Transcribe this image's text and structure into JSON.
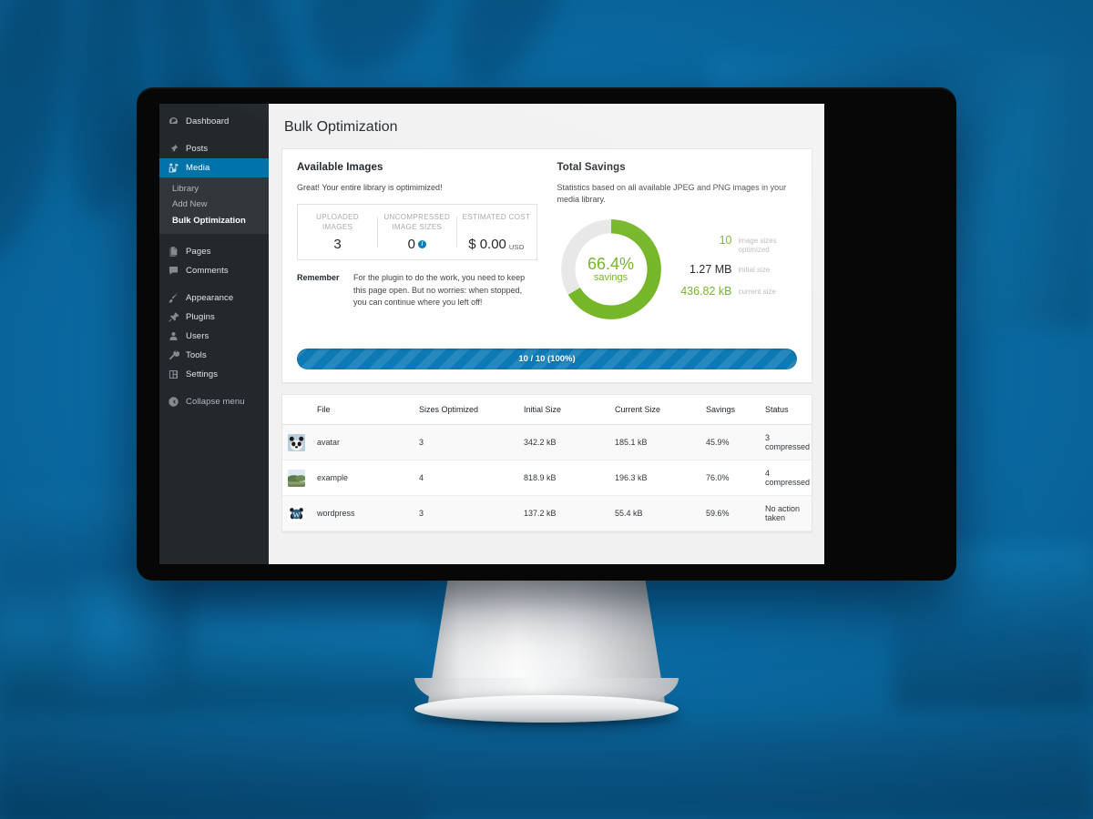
{
  "sidebar": {
    "items": [
      {
        "label": "Dashboard",
        "icon": "dashboard-icon",
        "current": false
      },
      {
        "label": "Posts",
        "icon": "pin-icon",
        "current": false
      },
      {
        "label": "Media",
        "icon": "media-icon",
        "current": true
      }
    ],
    "submenu": [
      {
        "label": "Library",
        "current": false
      },
      {
        "label": "Add New",
        "current": false
      },
      {
        "label": "Bulk Optimization",
        "current": true
      }
    ],
    "items2": [
      {
        "label": "Pages",
        "icon": "page-icon"
      },
      {
        "label": "Comments",
        "icon": "comment-icon"
      }
    ],
    "items3": [
      {
        "label": "Appearance",
        "icon": "brush-icon"
      },
      {
        "label": "Plugins",
        "icon": "plug-icon"
      },
      {
        "label": "Users",
        "icon": "user-icon"
      },
      {
        "label": "Tools",
        "icon": "wrench-icon"
      },
      {
        "label": "Settings",
        "icon": "settings-icon"
      }
    ],
    "collapse": {
      "label": "Collapse menu",
      "icon": "collapse-icon"
    }
  },
  "page": {
    "title": "Bulk Optimization"
  },
  "available": {
    "heading": "Available Images",
    "description": "Great! Your entire library is optimimized!",
    "stats": [
      {
        "label": "UPLOADED IMAGES",
        "value": "3",
        "unit": "",
        "info": false
      },
      {
        "label": "UNCOMPRESSED IMAGE SIZES",
        "value": "0",
        "unit": "",
        "info": true
      },
      {
        "label": "ESTIMATED COST",
        "value": "$ 0.00",
        "unit": "USD",
        "info": false
      }
    ],
    "remember_label": "Remember",
    "remember_text": "For the plugin to do the work, you need to keep this page open. But no worries: when stopped, you can continue where you left off!"
  },
  "savings": {
    "heading": "Total Savings",
    "description": "Statistics based on all available JPEG and PNG images in your media library.",
    "rows": [
      {
        "value": "10",
        "caption": "image sizes optimized",
        "color": "green"
      },
      {
        "value": "1.27 MB",
        "caption": "initial size",
        "color": "dark"
      },
      {
        "value": "436.82 kB",
        "caption": "current size",
        "color": "green"
      }
    ]
  },
  "chart_data": {
    "type": "pie",
    "title": "Total Savings",
    "labels": [
      "savings",
      "remaining"
    ],
    "values": [
      66.4,
      33.6
    ],
    "center_value": "66.4%",
    "center_label": "savings",
    "colors": [
      "#76b729",
      "#e8e8e8"
    ],
    "units": "percent",
    "start_angle_deg": 0,
    "direction": "clockwise",
    "donut": true
  },
  "progress": {
    "text": "10 / 10 (100%)",
    "percent": 100,
    "current": 10,
    "total": 10
  },
  "table": {
    "columns": [
      "",
      "File",
      "Sizes Optimized",
      "Initial Size",
      "Current Size",
      "Savings",
      "Status"
    ],
    "rows": [
      {
        "thumb": "panda-photo-thumbnail",
        "file": "avatar",
        "sizes": "3",
        "initial": "342.2 kB",
        "current": "185.1 kB",
        "savings": "45.9%",
        "status": "3 compressed"
      },
      {
        "thumb": "landscape-photo-thumbnail",
        "file": "example",
        "sizes": "4",
        "initial": "818.9 kB",
        "current": "196.3 kB",
        "savings": "76.0%",
        "status": "4 compressed"
      },
      {
        "thumb": "wordpress-logo-thumbnail",
        "file": "wordpress",
        "sizes": "3",
        "initial": "137.2 kB",
        "current": "55.4 kB",
        "savings": "59.6%",
        "status": "No action taken"
      }
    ]
  },
  "colors": {
    "wp_blue": "#0073aa",
    "sidebar_bg": "#23282d",
    "submenu_bg": "#32373c",
    "green": "#76b729",
    "progress_blue": "#0d7ab5",
    "background_blue": "#0a6ba4"
  }
}
